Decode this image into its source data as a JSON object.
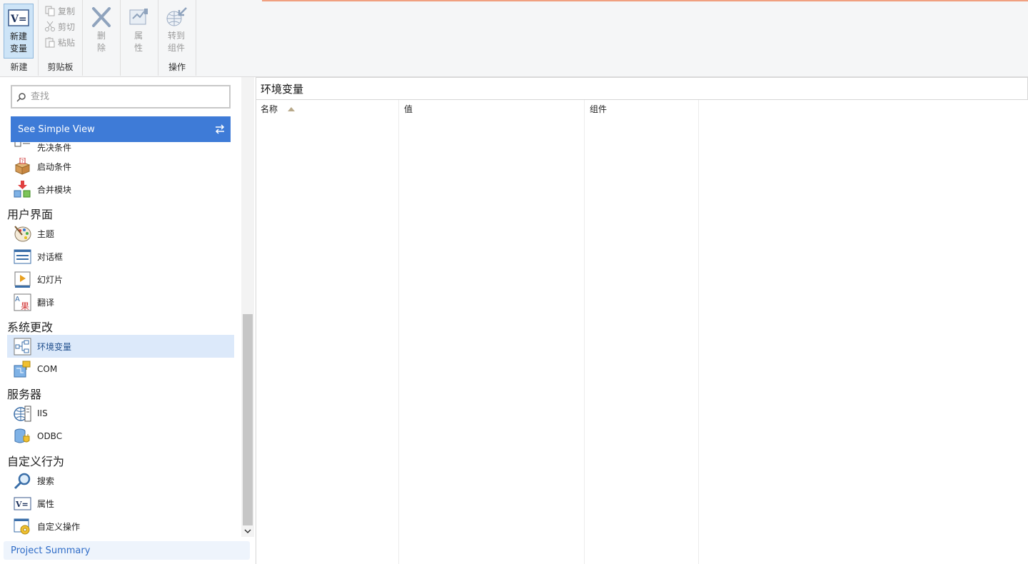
{
  "ribbon": {
    "new_variable": "新建变量",
    "copy": "复制",
    "cut": "剪切",
    "paste": "粘贴",
    "delete": "删除",
    "properties": "属性",
    "goto_component": "转到组件",
    "group_new": "新建",
    "group_clipboard": "剪贴板",
    "group_operations": "操作"
  },
  "sidebar": {
    "search_placeholder": "查找",
    "simple_view": "See Simple View",
    "partial_item": "先决条件",
    "items_top": [
      {
        "label": "启动条件",
        "icon": "launch-conditions-icon"
      },
      {
        "label": "合并模块",
        "icon": "merge-modules-icon"
      }
    ],
    "sections": [
      {
        "title": "用户界面",
        "items": [
          {
            "label": "主题",
            "icon": "theme-icon"
          },
          {
            "label": "对话框",
            "icon": "dialog-icon"
          },
          {
            "label": "幻灯片",
            "icon": "slideshow-icon"
          },
          {
            "label": "翻译",
            "icon": "translation-icon"
          }
        ]
      },
      {
        "title": "系统更改",
        "items": [
          {
            "label": "环境变量",
            "icon": "environment-variables-icon",
            "selected": true
          },
          {
            "label": "COM",
            "icon": "com-icon"
          }
        ]
      },
      {
        "title": "服务器",
        "items": [
          {
            "label": "IIS",
            "icon": "iis-icon"
          },
          {
            "label": "ODBC",
            "icon": "odbc-icon"
          }
        ]
      },
      {
        "title": "自定义行为",
        "items": [
          {
            "label": "搜索",
            "icon": "search-icon"
          },
          {
            "label": "属性",
            "icon": "properties-icon"
          },
          {
            "label": "自定义操作",
            "icon": "custom-actions-icon"
          }
        ]
      }
    ],
    "project_summary": "Project Summary"
  },
  "main": {
    "title": "环境变量",
    "columns": [
      "名称",
      "值",
      "组件"
    ],
    "sort_column": "名称",
    "sort_direction": "ascending"
  },
  "colors": {
    "accent_blue": "#3e7bd7",
    "selected_bg": "#dce9fa",
    "ribbon_active": "#cde4f7",
    "link_blue": "#2f6cc7"
  }
}
